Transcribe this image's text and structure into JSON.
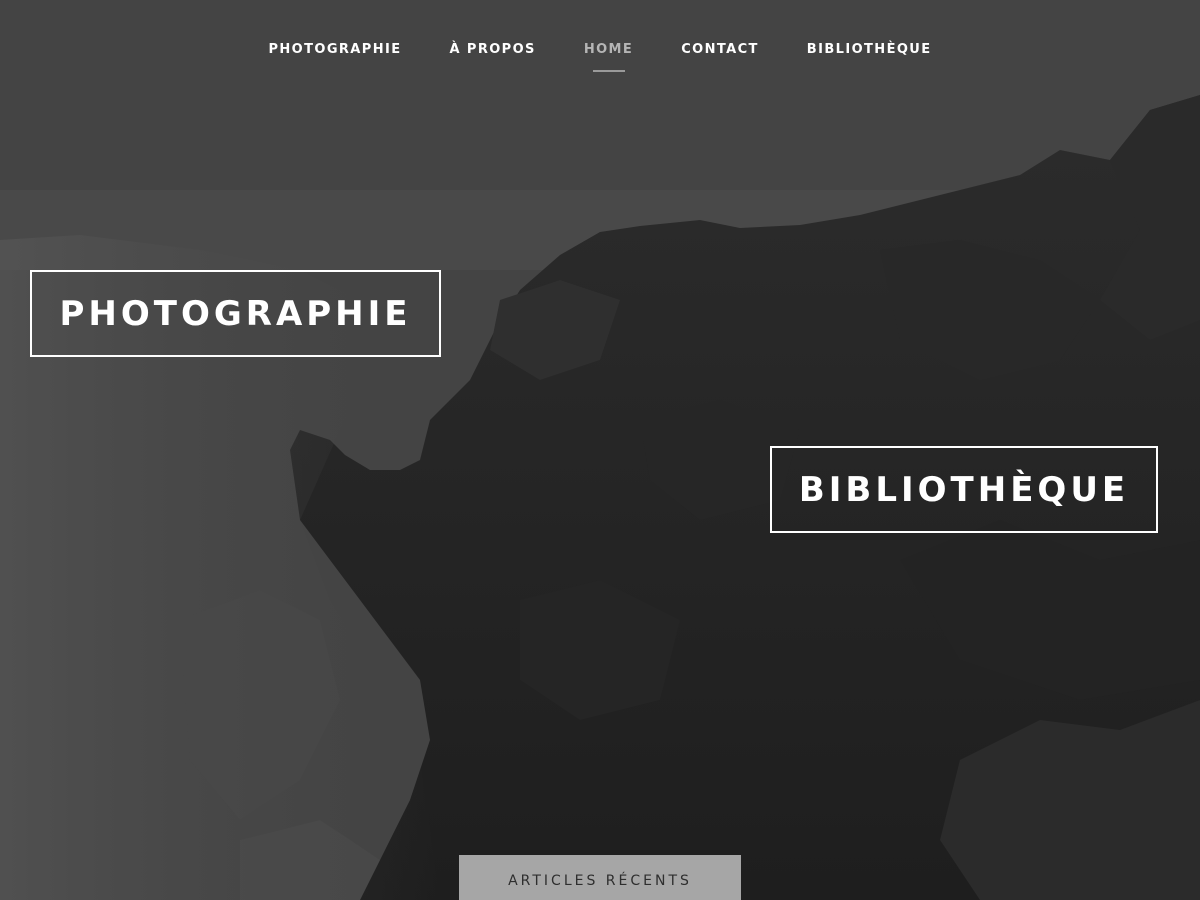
{
  "nav": {
    "items": [
      {
        "label": "PHOTOGRAPHIE",
        "active": false
      },
      {
        "label": "À PROPOS",
        "active": false
      },
      {
        "label": "HOME",
        "active": true
      },
      {
        "label": "CONTACT",
        "active": false
      },
      {
        "label": "BIBLIOTHÈQUE",
        "active": false
      }
    ]
  },
  "hero": {
    "photo_label": "PHOTOGRAPHIE",
    "biblio_label": "BIBLIOTHÈQUE"
  },
  "recent": {
    "label": "ARTICLES RÉCENTS"
  },
  "colors": {
    "nav_text": "#ffffff",
    "nav_active": "#b5b5b5",
    "tab_bg": "#a6a6a6",
    "tab_text": "#2e2e2e"
  }
}
